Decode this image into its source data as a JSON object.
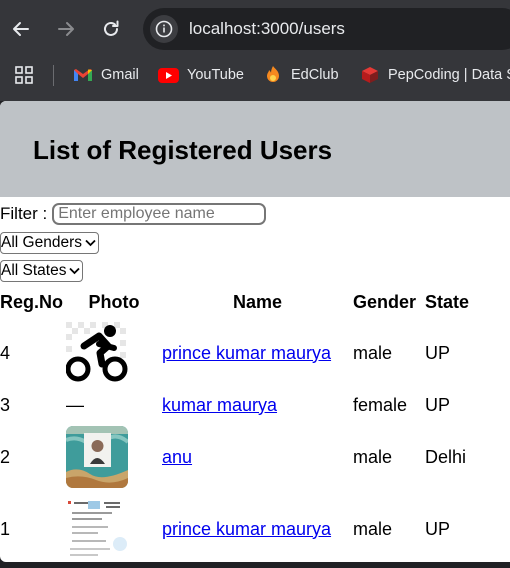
{
  "browser": {
    "url": "localhost:3000/users",
    "bookmarks": [
      {
        "label": "Gmail",
        "icon": "gmail-icon"
      },
      {
        "label": "YouTube",
        "icon": "youtube-icon"
      },
      {
        "label": "EdClub",
        "icon": "edclub-icon"
      },
      {
        "label": "PepCoding | Data S",
        "icon": "pepcoding-icon"
      }
    ]
  },
  "page": {
    "title": "List of Registered Users",
    "filter": {
      "label": "Filter :",
      "placeholder": "Enter employee name",
      "gender_selected": "All Genders",
      "state_selected": "All States"
    },
    "table": {
      "headers": {
        "reg_no": "Reg.No",
        "photo": "Photo",
        "name": "Name",
        "gender": "Gender",
        "state": "State"
      },
      "rows": [
        {
          "reg_no": "4",
          "photo": "cyclist-icon",
          "name": "prince kumar maurya",
          "gender": "male",
          "state": "UP"
        },
        {
          "reg_no": "3",
          "photo": "—",
          "name": "kumar maurya",
          "gender": "female",
          "state": "UP"
        },
        {
          "reg_no": "2",
          "photo": "portrait-photo",
          "name": "anu",
          "gender": "male",
          "state": "Delhi"
        },
        {
          "reg_no": "1",
          "photo": "document-photo",
          "name": "prince kumar maurya",
          "gender": "male",
          "state": "UP"
        }
      ]
    }
  },
  "colors": {
    "banner": "#bec2c6",
    "link": "#0000ee",
    "chrome": "#35363a"
  }
}
